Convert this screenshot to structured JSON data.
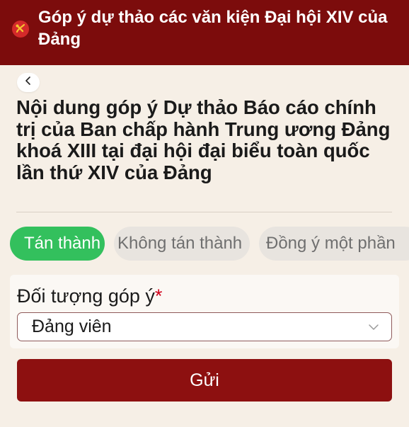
{
  "header": {
    "title": "Góp ý dự thảo các văn kiện Đại hội XIV của Đảng",
    "emblem_icon": "party-emblem-icon",
    "background_color": "#7c0c0c"
  },
  "back_button": {
    "icon": "chevron-left-icon",
    "glyph": "<"
  },
  "page_title": "Nội dung góp ý Dự thảo Báo cáo chính trị của Ban chấp hành Trung ương Đảng khoá XIII tại đại hội đại biểu toàn quốc lần thứ XIV của Đảng",
  "opinion_options": [
    {
      "label": "Tán thành",
      "selected": true,
      "color": "#33c05d"
    },
    {
      "label": "Không tán thành",
      "selected": false
    },
    {
      "label": "Đồng ý một phần",
      "selected": false
    }
  ],
  "form": {
    "subject_label": "Đối tượng góp ý",
    "required_mark": "*",
    "subject_value": "Đảng viên",
    "dropdown_icon": "chevron-down-icon"
  },
  "submit_button": {
    "label": "Gửi",
    "color": "#8d1010"
  }
}
